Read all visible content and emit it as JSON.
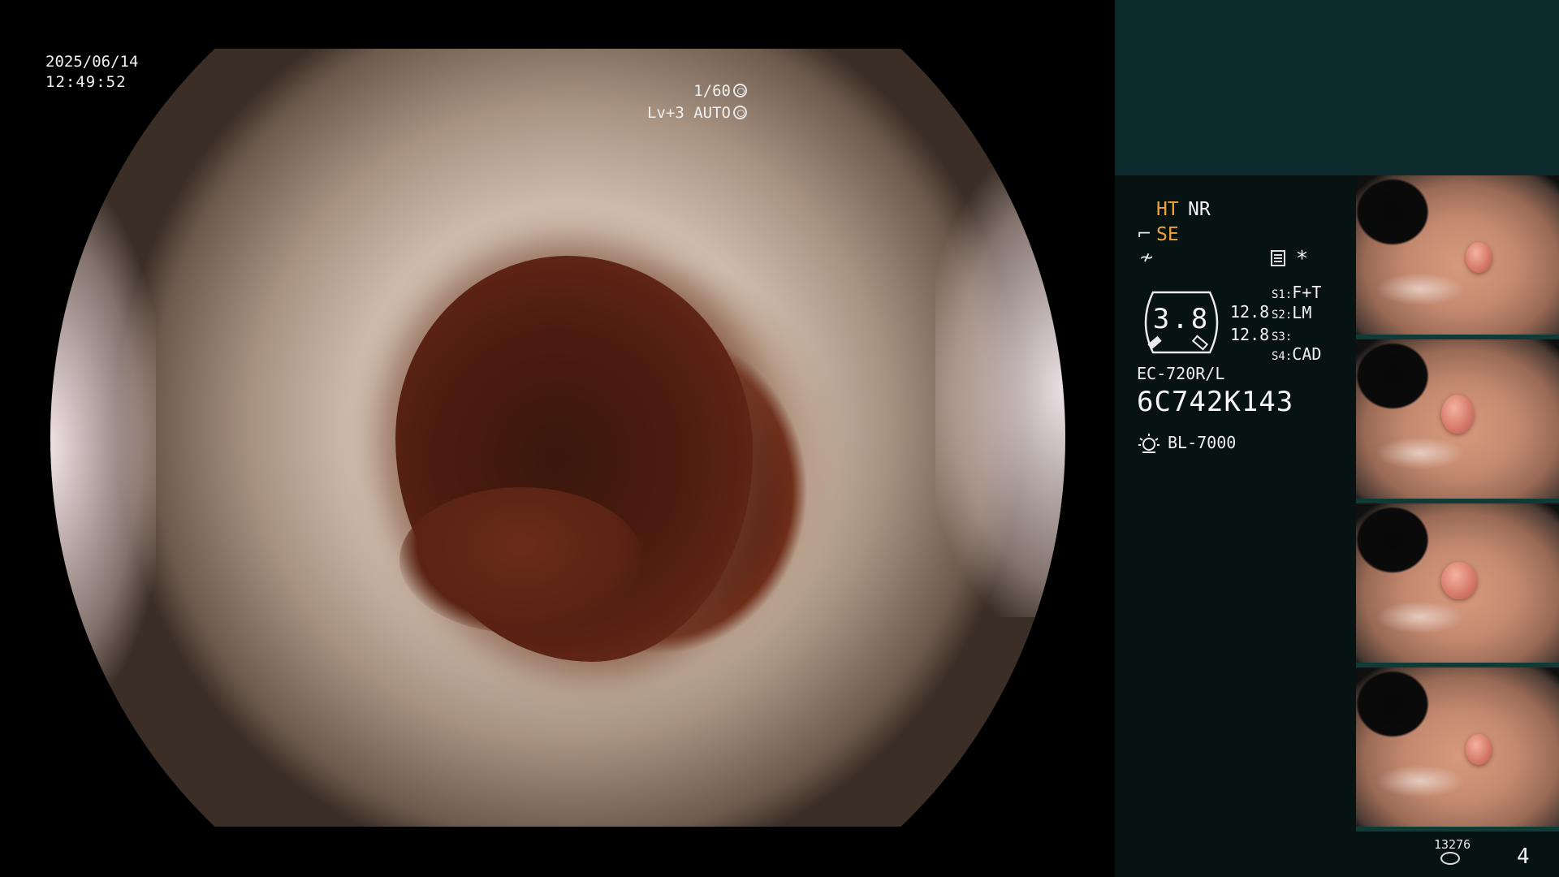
{
  "overlay": {
    "date": "2025/06/14",
    "time": "12:49:52",
    "shutter": "1/60",
    "level": "Lv+3 AUTO"
  },
  "panel": {
    "ht": "HT",
    "nr": "NR",
    "se": "SE",
    "asterisk": "*",
    "gauge_value": "3.8",
    "val1": "12.8",
    "val2": "12.8",
    "settings": [
      {
        "key": "S1:",
        "value": "F+T"
      },
      {
        "key": "S2:",
        "value": "LM"
      },
      {
        "key": "S3:",
        "value": ""
      },
      {
        "key": "S4:",
        "value": "CAD"
      }
    ],
    "scope_model": "EC-720R/L",
    "serial": "6C742K143",
    "lamp": "BL-7000",
    "storage_count": "13276",
    "page_count": "4"
  },
  "colors": {
    "accent_orange": "#f2a23a",
    "panel_top": "#0c2a2c",
    "panel_main": "#071212"
  },
  "icons": {
    "shutter_icon": "aperture-icon",
    "level_icon": "auto-iris-icon",
    "lamp_icon": "lamp-icon",
    "storage_icon": "storage-icon"
  }
}
